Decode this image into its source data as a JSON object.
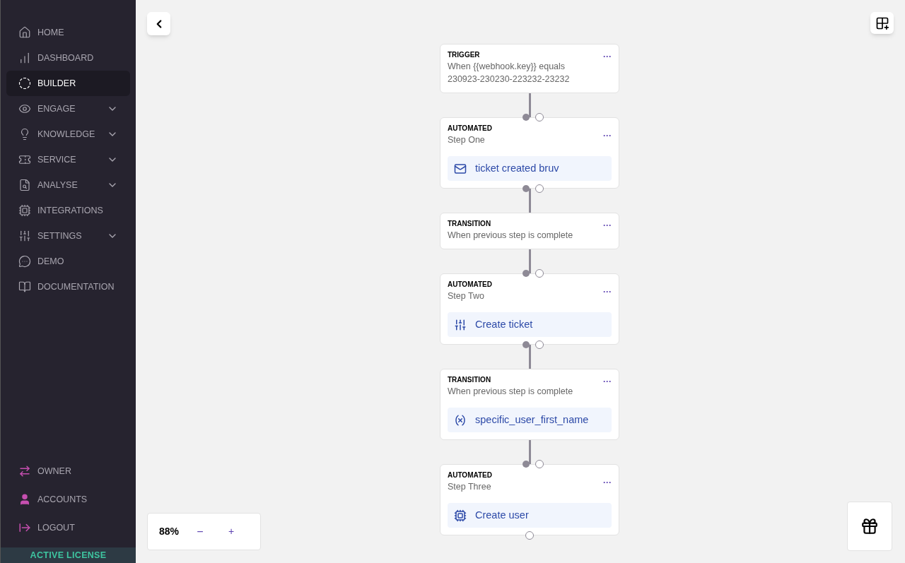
{
  "sidebar": {
    "items": [
      {
        "label": "HOME",
        "selected": false,
        "expandable": false
      },
      {
        "label": "DASHBOARD",
        "selected": false,
        "expandable": false
      },
      {
        "label": "BUILDER",
        "selected": true,
        "expandable": false
      },
      {
        "label": "ENGAGE",
        "selected": false,
        "expandable": true
      },
      {
        "label": "KNOWLEDGE",
        "selected": false,
        "expandable": true
      },
      {
        "label": "SERVICE",
        "selected": false,
        "expandable": true
      },
      {
        "label": "ANALYSE",
        "selected": false,
        "expandable": true
      },
      {
        "label": "INTEGRATIONS",
        "selected": false,
        "expandable": false
      },
      {
        "label": "SETTINGS",
        "selected": false,
        "expandable": true
      },
      {
        "label": "DEMO",
        "selected": false,
        "expandable": false
      },
      {
        "label": "DOCUMENTATION",
        "selected": false,
        "expandable": false
      }
    ],
    "account_items": [
      {
        "label": "OWNER"
      },
      {
        "label": "ACCOUNTS"
      },
      {
        "label": "LOGOUT"
      }
    ],
    "license_badge": "ACTIVE LICENSE"
  },
  "flow": {
    "nodes": [
      {
        "kind": "trigger",
        "type": "TRIGGER",
        "title": "When {{webhook.key}} equals 230923-230230-223232-23232",
        "menu": "···"
      },
      {
        "kind": "automated",
        "type": "AUTOMATED",
        "title": "Step One",
        "menu": "···",
        "action": "ticket created bruv"
      },
      {
        "kind": "transition",
        "type": "TRANSITION",
        "title": "When previous step is complete",
        "menu": "···"
      },
      {
        "kind": "automated",
        "type": "AUTOMATED",
        "title": "Step Two",
        "menu": "···",
        "action": "Create ticket"
      },
      {
        "kind": "transition",
        "type": "TRANSITION",
        "title": "When previous step is complete",
        "menu": "···",
        "action": "specific_user_first_name"
      },
      {
        "kind": "automated",
        "type": "AUTOMATED",
        "title": "Step Three",
        "menu": "···",
        "action": "Create user"
      }
    ]
  },
  "zoom": {
    "value": "88%",
    "minus": "−",
    "plus": "+"
  }
}
